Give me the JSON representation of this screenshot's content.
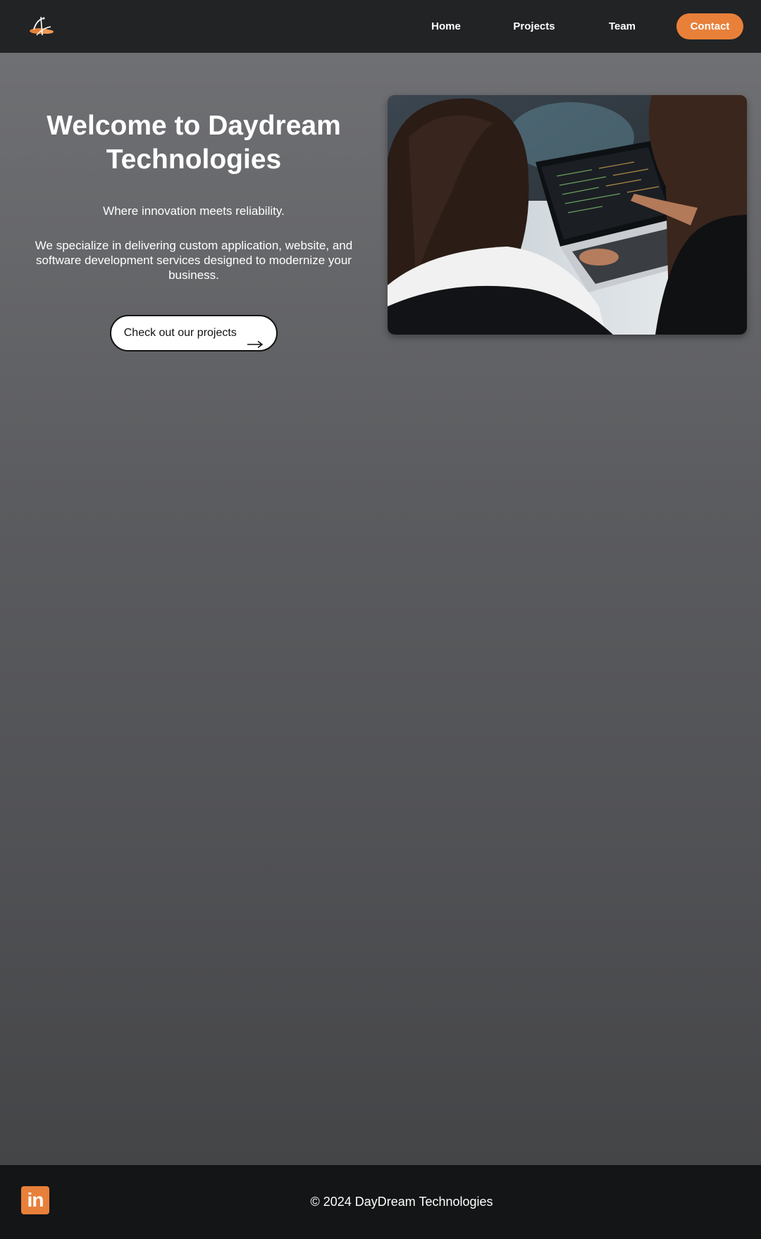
{
  "header": {
    "logo_icon": "daydream-logo-icon",
    "nav": {
      "home_label": "Home",
      "projects_label": "Projects",
      "team_label": "Team",
      "contact_label": "Contact"
    },
    "accent_color": "#e8803a"
  },
  "hero": {
    "title": "Welcome to Daydream Technologies",
    "tagline": "Where innovation meets reliability.",
    "description": "We specialize in delivering custom application, website, and software development services designed to modernize your business.",
    "cta_label": "Check out our projects",
    "cta_icon": "arrow-right-icon",
    "photo_subject": "two-women-reviewing-code-on-laptop"
  },
  "footer": {
    "social_icon": "linkedin-icon",
    "linkedin_glyph": "in",
    "copyright": "© 2024 DayDream Technologies"
  }
}
